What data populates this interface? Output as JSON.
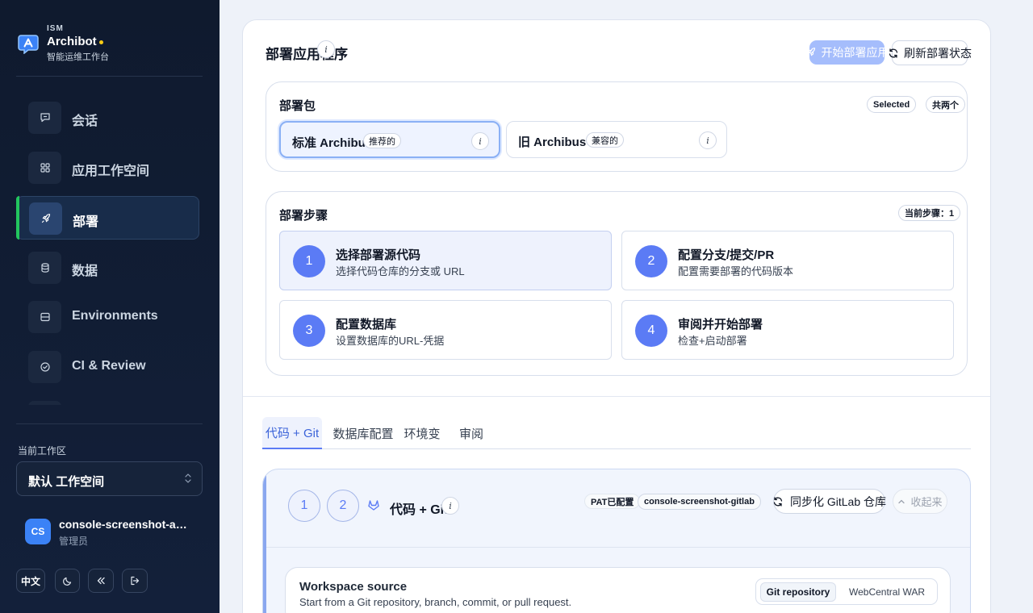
{
  "brand": {
    "small": "ISM",
    "name": "Archibot",
    "subtitle": "智能运维工作台"
  },
  "nav": [
    {
      "label": "会话",
      "icon": "chat-icon"
    },
    {
      "label": "应用工作空间",
      "icon": "grid-icon"
    },
    {
      "label": "部署",
      "icon": "rocket-icon"
    },
    {
      "label": "数据",
      "icon": "database-icon"
    },
    {
      "label": "Environments",
      "icon": "server-icon"
    },
    {
      "label": "CI & Review",
      "icon": "check-circle-icon"
    }
  ],
  "workspace": {
    "label": "当前工作区",
    "value": "默认 工作空间"
  },
  "user": {
    "initials": "CS",
    "name": "console-screenshot-admin",
    "role": "管理员"
  },
  "footer": {
    "lang_label": "中文"
  },
  "header": {
    "title": "部署应用程序",
    "deploy_label": "开始部署应用",
    "refresh_label": "刷新部署状态"
  },
  "package": {
    "title": "部署包",
    "selected_chip": "Selected",
    "count_chip": "共两个",
    "options": [
      {
        "name": "标准 Archibus",
        "badge": "推荐的"
      },
      {
        "name": "旧 Archibus",
        "badge": "兼容的"
      }
    ]
  },
  "steps": {
    "title": "部署步骤",
    "progress": "当前步骤：1",
    "items": [
      {
        "num": "1",
        "title": "选择部署源代码",
        "sub": "选择代码仓库的分支或 URL"
      },
      {
        "num": "2",
        "title": "配置分支/提交/PR",
        "sub": "配置需要部署的代码版本"
      },
      {
        "num": "3",
        "title": "配置数据库",
        "sub": "设置数据库的URL-凭据"
      },
      {
        "num": "4",
        "title": "审阅并开始部署",
        "sub": "检查+启动部署"
      }
    ]
  },
  "tabs": [
    "代码 + Git",
    "数据库配置",
    "环境变",
    "审阅"
  ],
  "source": {
    "bubbles": [
      "1",
      "2"
    ],
    "title": "代码 + Git",
    "pat_chip": "PAT已配置",
    "repo_chip": "console-screenshot-gitlab",
    "sync_label": "同步化 GitLab 仓库",
    "collapse_label": "收起来"
  },
  "ws_source": {
    "title": "Workspace source",
    "desc": "Start from a Git repository, branch, commit, or pull request.",
    "options": [
      "Git repository",
      "WebCentral WAR"
    ]
  },
  "colors": {
    "sidebar": "#0f1a2e",
    "accent": "#5b7bf5",
    "active_bar": "#22c55e",
    "brand_dot": "#facc15"
  }
}
